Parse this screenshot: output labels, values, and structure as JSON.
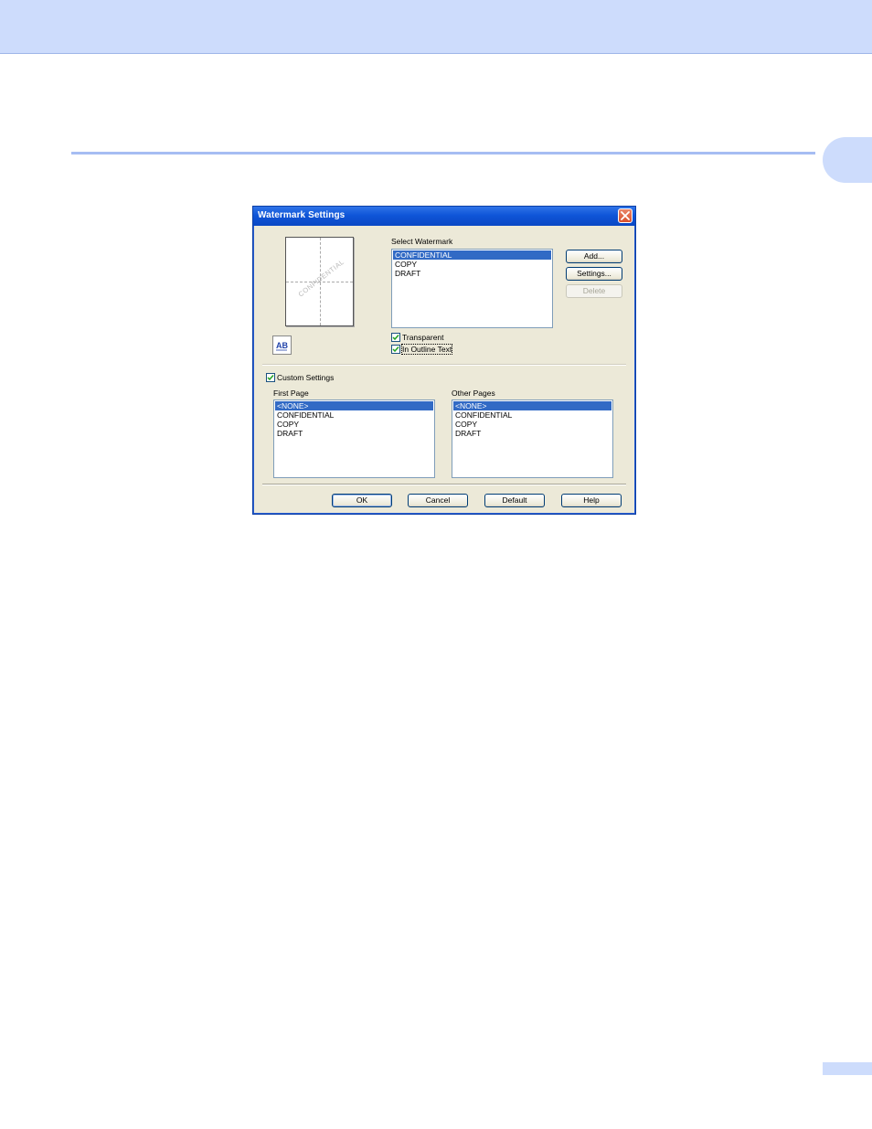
{
  "dialog": {
    "title": "Watermark Settings",
    "preview_watermark": "CONFIDENTIAL",
    "select_label": "Select Watermark",
    "watermarks": [
      "CONFIDENTIAL",
      "COPY",
      "DRAFT"
    ],
    "selected_watermark": "CONFIDENTIAL",
    "buttons": {
      "add": "Add...",
      "settings": "Settings...",
      "delete": "Delete",
      "ok": "OK",
      "cancel": "Cancel",
      "default": "Default",
      "help": "Help"
    },
    "transparent": {
      "label": "Transparent",
      "checked": true
    },
    "outline": {
      "label": "In Outline Text",
      "checked": true
    },
    "custom_settings": {
      "label": "Custom Settings",
      "checked": true
    },
    "first_page": {
      "label": "First Page",
      "items": [
        "<NONE>",
        "CONFIDENTIAL",
        "COPY",
        "DRAFT"
      ],
      "selected": "<NONE>"
    },
    "other_pages": {
      "label": "Other Pages",
      "items": [
        "<NONE>",
        "CONFIDENTIAL",
        "COPY",
        "DRAFT"
      ],
      "selected": "<NONE>"
    }
  },
  "colors": {
    "header_band": "#cddcfc",
    "section_rule": "#a6bdf3",
    "titlebar": "#0f55d8",
    "selection": "#316ac5",
    "dialog_face": "#ece9d8"
  }
}
